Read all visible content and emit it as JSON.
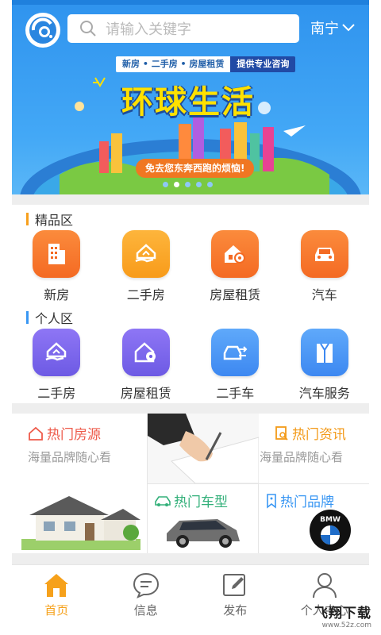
{
  "header": {
    "search_placeholder": "请输入关键字",
    "city": "南宁"
  },
  "banner": {
    "tag_left": "新房 • 二手房 • 房屋租赁",
    "tag_right": "提供专业咨询",
    "title": "环球生活",
    "subtitle": "免去您东奔西跑的烦恼!",
    "slide_count": 5,
    "active_slide": 2
  },
  "premium": {
    "title": "精品区",
    "items": [
      {
        "label": "新房",
        "icon": "building-icon"
      },
      {
        "label": "二手房",
        "icon": "house-hand-icon"
      },
      {
        "label": "房屋租赁",
        "icon": "house-key-icon"
      },
      {
        "label": "汽车",
        "icon": "car-icon"
      }
    ]
  },
  "personal": {
    "title": "个人区",
    "items": [
      {
        "label": "二手房",
        "icon": "house-hand-icon"
      },
      {
        "label": "房屋租赁",
        "icon": "house-key-icon"
      },
      {
        "label": "二手车",
        "icon": "car-swap-icon"
      },
      {
        "label": "汽车服务",
        "icon": "suit-icon"
      }
    ]
  },
  "hot": {
    "house_title": "热门房源",
    "house_sub": "海量品牌随心看",
    "news_title": "热门资讯",
    "news_sub": "海量品牌随心看",
    "car_title": "热门车型",
    "brand_title": "热门品牌",
    "brand_logo_text": "BMW"
  },
  "bottom_nav": [
    {
      "label": "首页",
      "icon": "home-icon"
    },
    {
      "label": "信息",
      "icon": "chat-icon"
    },
    {
      "label": "发布",
      "icon": "edit-icon"
    },
    {
      "label": "个人中心",
      "icon": "person-icon"
    }
  ],
  "watermark": {
    "main": "飞翔下载",
    "sub": "www.52z.com"
  },
  "colors": {
    "header_blue": "#3a9cf2",
    "active_nav": "#f6a11b",
    "hot_red": "#ee5a4a",
    "hot_amber": "#f39a18",
    "hot_green": "#33b07a",
    "hot_blue": "#3a97f3"
  }
}
